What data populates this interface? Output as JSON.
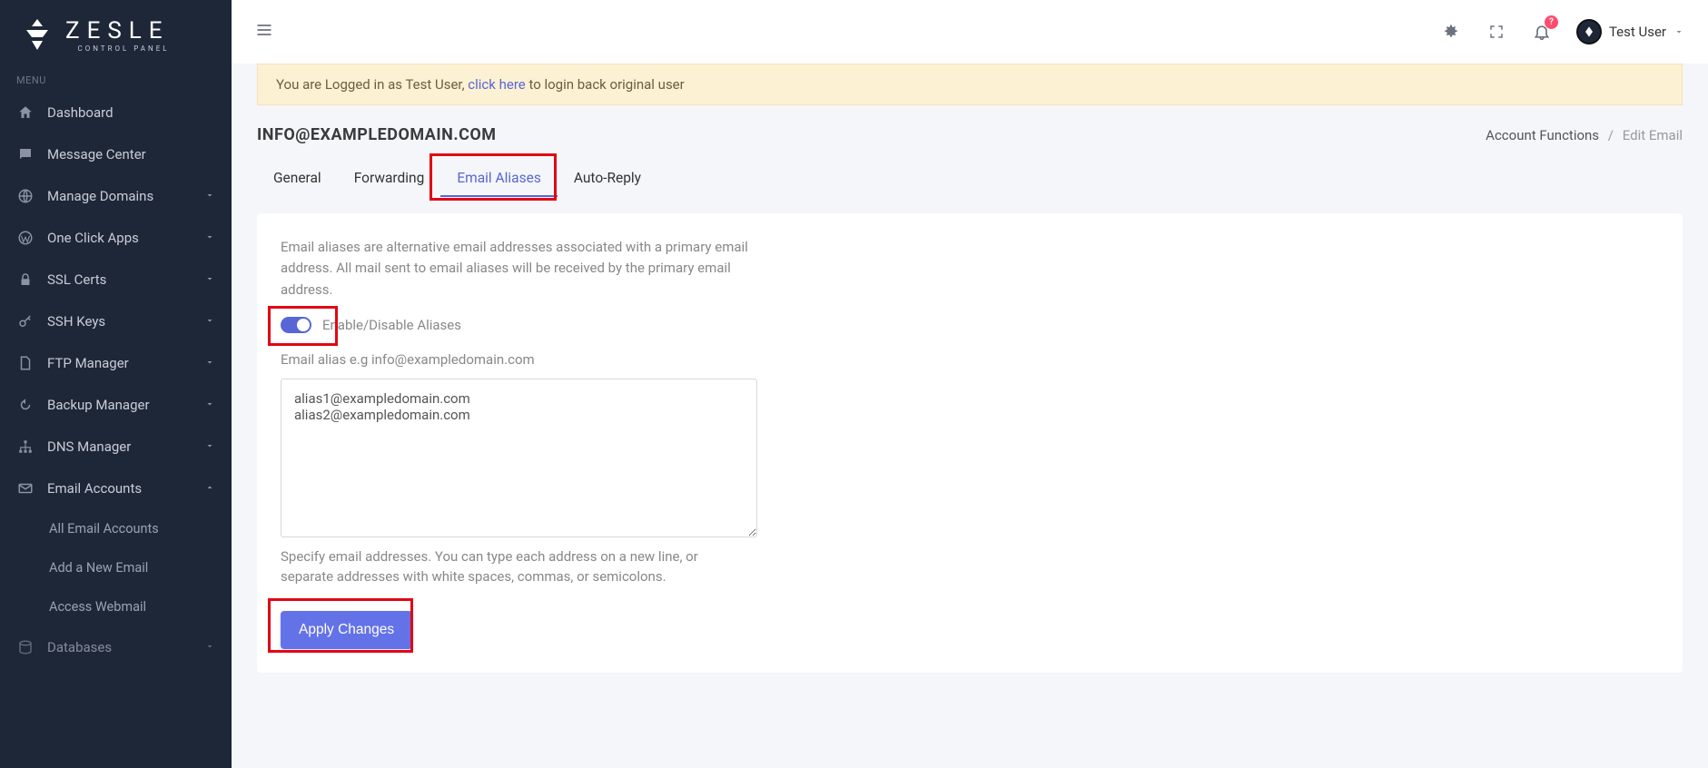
{
  "brand": {
    "name": "ZESLE",
    "sub": "CONTROL PANEL"
  },
  "menu_label": "MENU",
  "sidebar": {
    "items": [
      {
        "label": "Dashboard"
      },
      {
        "label": "Message Center"
      },
      {
        "label": "Manage Domains"
      },
      {
        "label": "One Click Apps"
      },
      {
        "label": "SSL Certs"
      },
      {
        "label": "SSH Keys"
      },
      {
        "label": "FTP Manager"
      },
      {
        "label": "Backup Manager"
      },
      {
        "label": "DNS Manager"
      },
      {
        "label": "Email Accounts"
      },
      {
        "label": "All Email Accounts"
      },
      {
        "label": "Add a New Email"
      },
      {
        "label": "Access Webmail"
      },
      {
        "label": "Databases"
      }
    ]
  },
  "topbar": {
    "notif_badge": "?",
    "user_name": "Test User"
  },
  "notice": {
    "prefix": "You are Logged in as Test User, ",
    "link": "click here",
    "suffix": " to login back original user"
  },
  "page": {
    "title": "INFO@EXAMPLEDOMAIN.COM",
    "breadcrumb_parent": "Account Functions",
    "breadcrumb_current": "Edit Email"
  },
  "tabs": [
    {
      "label": "General"
    },
    {
      "label": "Forwarding"
    },
    {
      "label": "Email Aliases"
    },
    {
      "label": "Auto-Reply"
    }
  ],
  "aliases": {
    "description": "Email aliases are alternative email addresses associated with a primary email address. All mail sent to email aliases will be received by the primary email address.",
    "toggle_label": "Enable/Disable Aliases",
    "field_label": "Email alias e.g info@exampledomain.com",
    "textarea_value": "alias1@exampledomain.com\nalias2@exampledomain.com",
    "help": "Specify email addresses. You can type each address on a new line, or separate addresses with white spaces, commas, or semicolons.",
    "apply_button": "Apply Changes"
  }
}
